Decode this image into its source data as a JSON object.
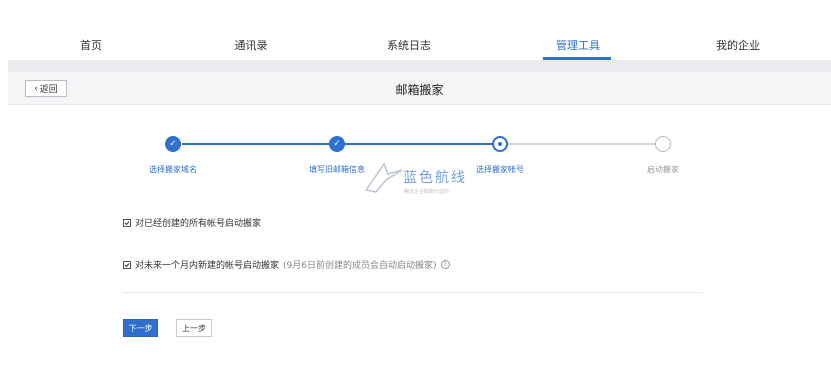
{
  "nav": {
    "items": [
      {
        "label": "首页"
      },
      {
        "label": "通讯录"
      },
      {
        "label": "系统日志"
      },
      {
        "label": "管理工具"
      },
      {
        "label": "我的企业"
      }
    ],
    "active": "管理工具"
  },
  "titlebar": {
    "back_label": "返回",
    "title": "邮箱搬家"
  },
  "steps": [
    {
      "label": "选择搬家域名",
      "state": "done"
    },
    {
      "label": "填写旧邮箱信息",
      "state": "done"
    },
    {
      "label": "选择搬家帐号",
      "state": "current"
    },
    {
      "label": "启动搬家",
      "state": "future"
    }
  ],
  "watermark": {
    "title": "蓝色航线",
    "subtitle": "腾讯企业邮箱代理商"
  },
  "options": {
    "existing": {
      "label": "对已经创建的所有帐号启动搬家",
      "checked": true
    },
    "future": {
      "label": "对未来一个月内新建的帐号启动搬家",
      "note": "(9月6日前创建的成员会自动启动搬家)",
      "checked": true
    }
  },
  "buttons": {
    "next": "下一步",
    "prev": "上一步"
  },
  "colors": {
    "accent": "#2f6fd0",
    "inactive": "#b4b8be"
  }
}
